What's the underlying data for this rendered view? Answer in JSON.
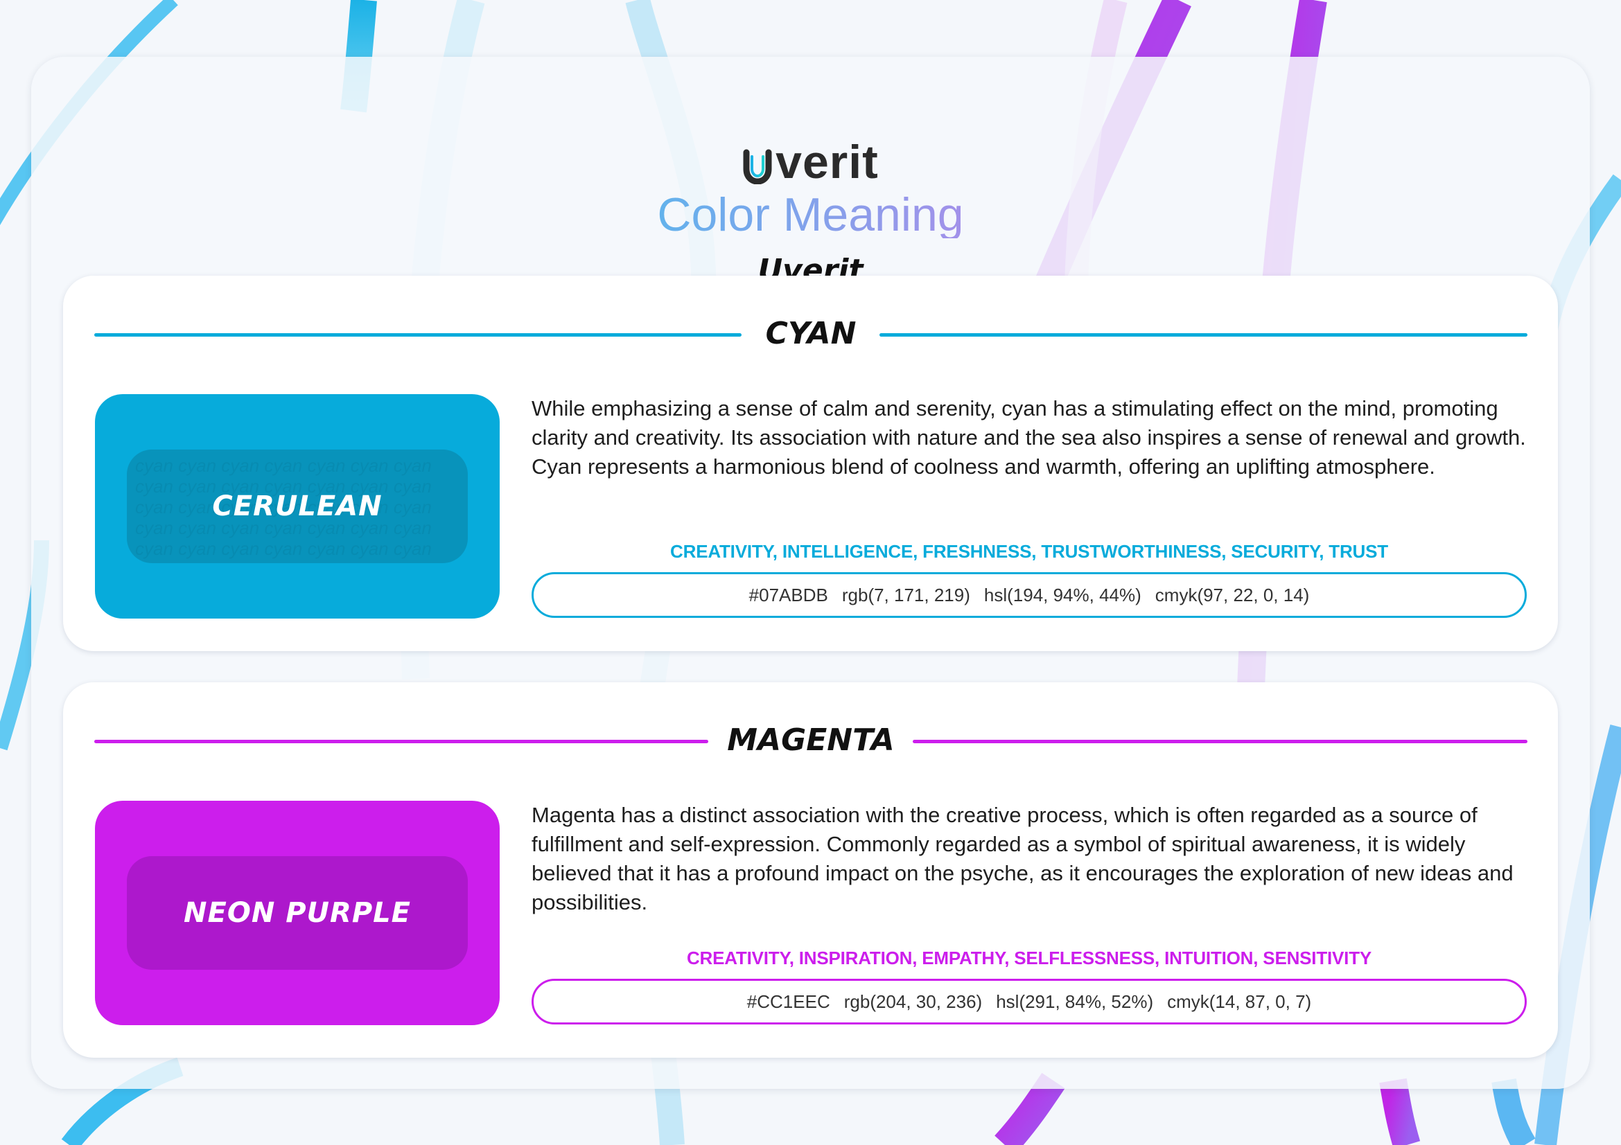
{
  "brand": {
    "logo_text": "verit"
  },
  "title": "Color Meaning",
  "subtitle": "Uverit",
  "colors": [
    {
      "name": "CYAN",
      "accent": "#07ABDB",
      "swatch_color": "#07ABDB",
      "swatch_inner": "#0893bb",
      "swatch_label": "CERULEAN",
      "swatch_pattern": "cyan cyan cyan cyan cyan cyan cyan",
      "description": "While emphasizing a sense of calm and serenity, cyan has a stimulating effect on the mind, promoting clarity and creativity. Its association with nature and the sea also inspires a sense of renewal and growth. Cyan represents a harmonious blend of coolness and warmth, offering an uplifting atmosphere.",
      "keywords": "CREATIVITY, INTELLIGENCE, FRESHNESS, TRUSTWORTHINESS, SECURITY, TRUST",
      "hex": "#07ABDB",
      "rgb": "rgb(7, 171, 219)",
      "hsl": "hsl(194, 94%, 44%)",
      "cmyk": "cmyk(97, 22, 0, 14)"
    },
    {
      "name": "MAGENTA",
      "accent": "#CC1EEC",
      "swatch_color": "#CC1EEC",
      "swatch_inner": "#ad18cc",
      "swatch_label": "NEON PURPLE",
      "swatch_pattern": "",
      "description": "Magenta has a distinct association with the creative process, which is often regarded as a source of fulfillment and self-expression. Commonly regarded as a symbol of spiritual awareness, it is widely believed that it has a profound impact on the psyche, as it encourages the exploration of new ideas and possibilities.",
      "keywords": "CREATIVITY, INSPIRATION, EMPATHY, SELFLESSNESS, INTUITION, SENSITIVITY",
      "hex": "#CC1EEC",
      "rgb": "rgb(204, 30, 236)",
      "hsl": "hsl(291, 84%, 52%)",
      "cmyk": "cmyk(14, 87, 0, 7)"
    }
  ]
}
